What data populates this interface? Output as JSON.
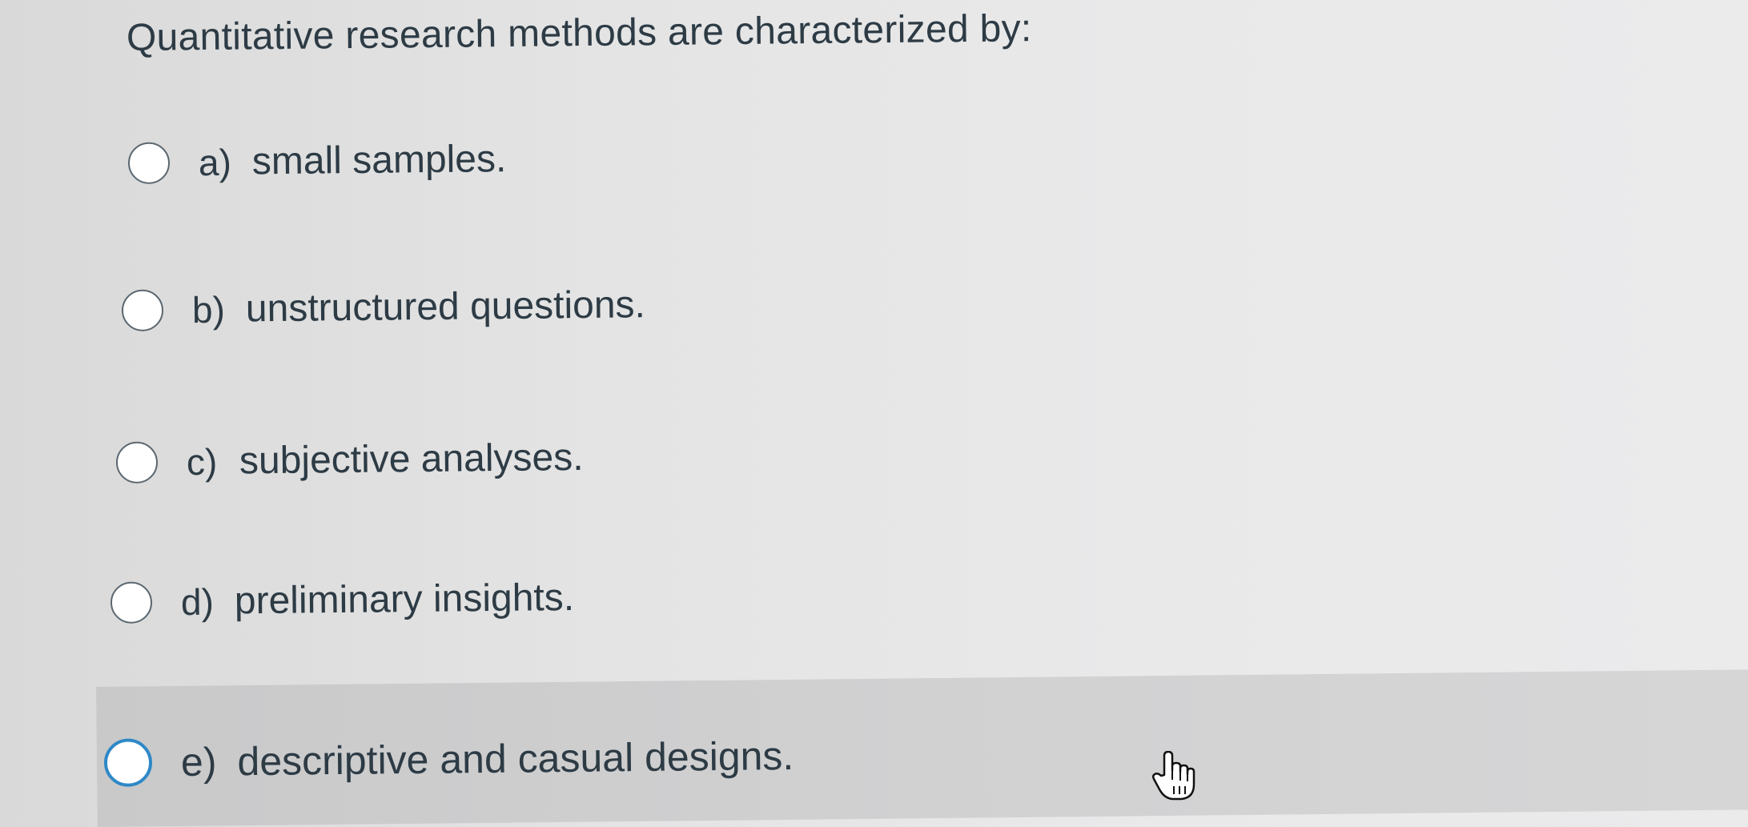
{
  "question": {
    "text": "Quantitative research methods are characterized by:"
  },
  "answers": [
    {
      "letter": "a)",
      "text": "small samples."
    },
    {
      "letter": "b)",
      "text": "unstructured questions."
    },
    {
      "letter": "c)",
      "text": "subjective analyses."
    },
    {
      "letter": "d)",
      "text": "preliminary insights."
    },
    {
      "letter": "e)",
      "text": "descriptive and casual designs."
    }
  ],
  "hovered_answer": "e)",
  "cursor": {
    "icon": "hand-pointer-icon"
  },
  "colors": {
    "text": "#2d3b45",
    "radio_border": "#5b6770",
    "radio_hover_border": "#2e88c7",
    "hover_band": "#cfcfd0"
  }
}
